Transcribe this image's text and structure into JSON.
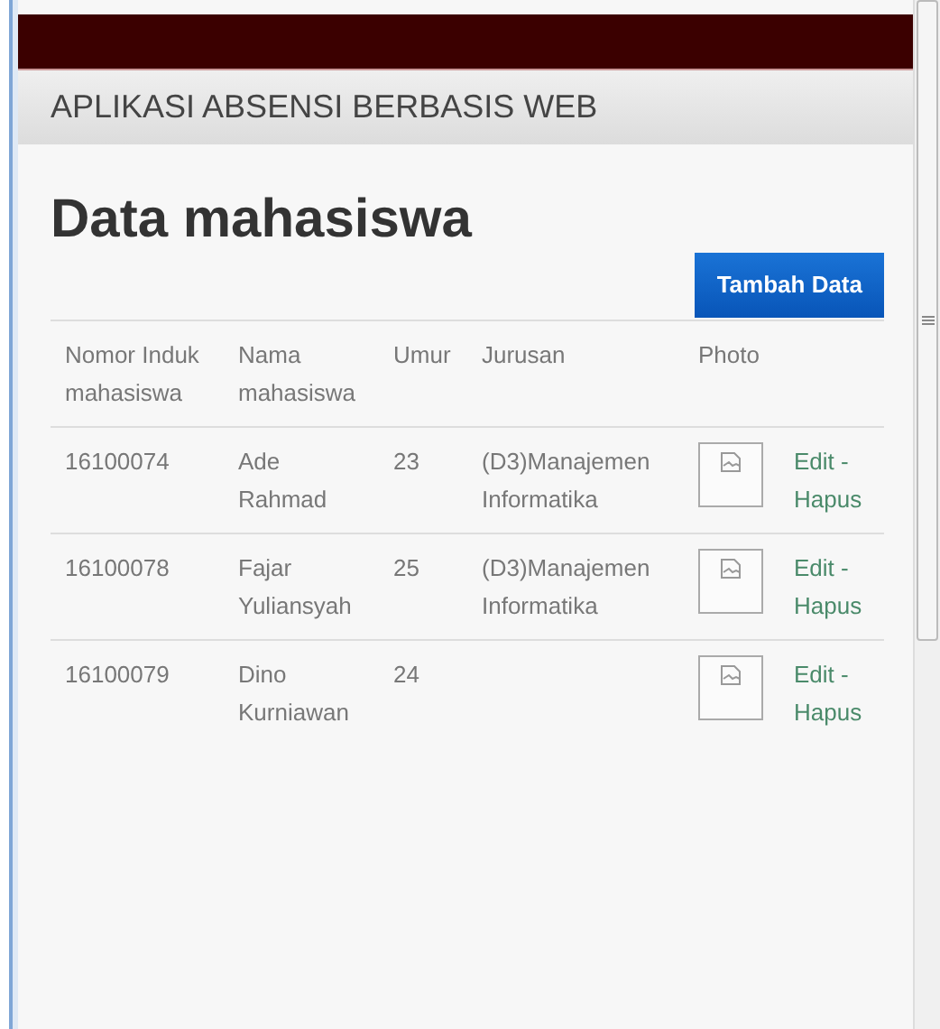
{
  "navbar": {
    "title": "APLIKASI ABSENSI BERBASIS WEB"
  },
  "heading": "Data mahasiswa",
  "add_button": "Tambah Data",
  "table": {
    "columns": [
      "Nomor Induk mahasiswa",
      "Nama mahasiswa",
      "Umur",
      "Jurusan",
      "Photo"
    ],
    "rows": [
      {
        "nim": "16100074",
        "nama": "Ade Rahmad",
        "umur": "23",
        "jurusan": "(D3)Manajemen Informatika",
        "edit": "Edit",
        "separator": "-",
        "delete": "Hapus"
      },
      {
        "nim": "16100078",
        "nama": "Fajar Yuliansyah",
        "umur": "25",
        "jurusan": "(D3)Manajemen Informatika",
        "edit": "Edit",
        "separator": "-",
        "delete": "Hapus"
      },
      {
        "nim": "16100079",
        "nama": "Dino Kurniawan",
        "umur": "24",
        "edit": "Edit",
        "separator": "-",
        "delete": "Hapus"
      }
    ]
  }
}
